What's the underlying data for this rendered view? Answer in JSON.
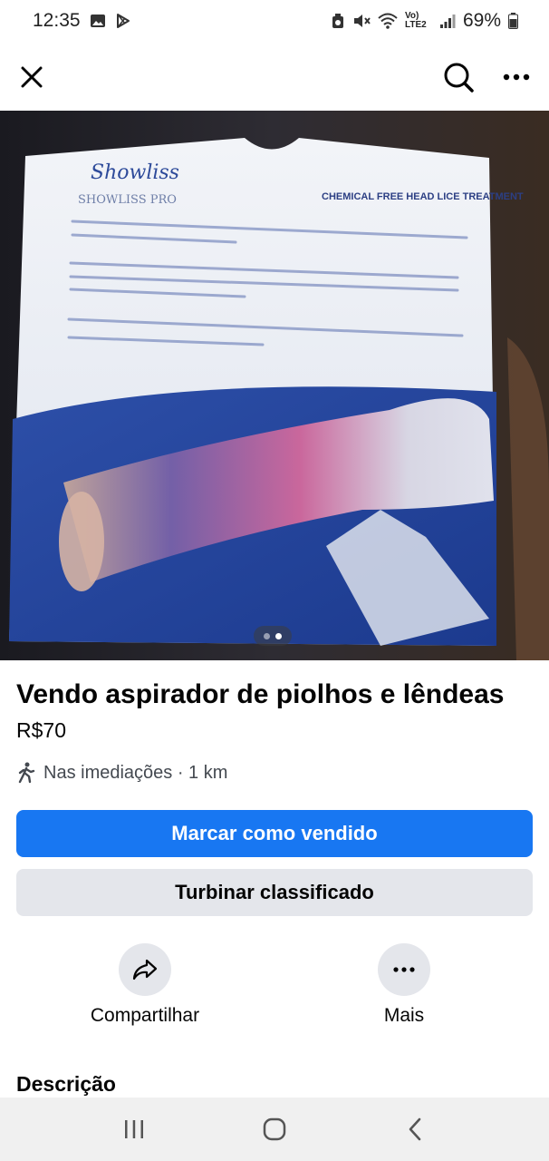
{
  "status_bar": {
    "time": "12:35",
    "network": "Vo) LTE2",
    "battery": "69%"
  },
  "listing": {
    "title": "Vendo aspirador de piolhos e lêndeas",
    "price": "R$70",
    "location": "Nas imediações · 1 km",
    "photo_count": 2,
    "active_photo": 2
  },
  "product_photo": {
    "brand": "Showliss",
    "model": "SHOWLISS PRO",
    "headline": "CHEMICAL FREE HEAD LICE TREATMENT"
  },
  "buttons": {
    "mark_sold": "Marcar como vendido",
    "boost": "Turbinar classificado"
  },
  "actions": {
    "share": "Compartilhar",
    "more": "Mais"
  },
  "sections": {
    "description": "Descrição"
  },
  "colors": {
    "primary": "#1877f2",
    "secondary_bg": "#e4e6eb",
    "nav_bg": "#f0f0f0"
  }
}
